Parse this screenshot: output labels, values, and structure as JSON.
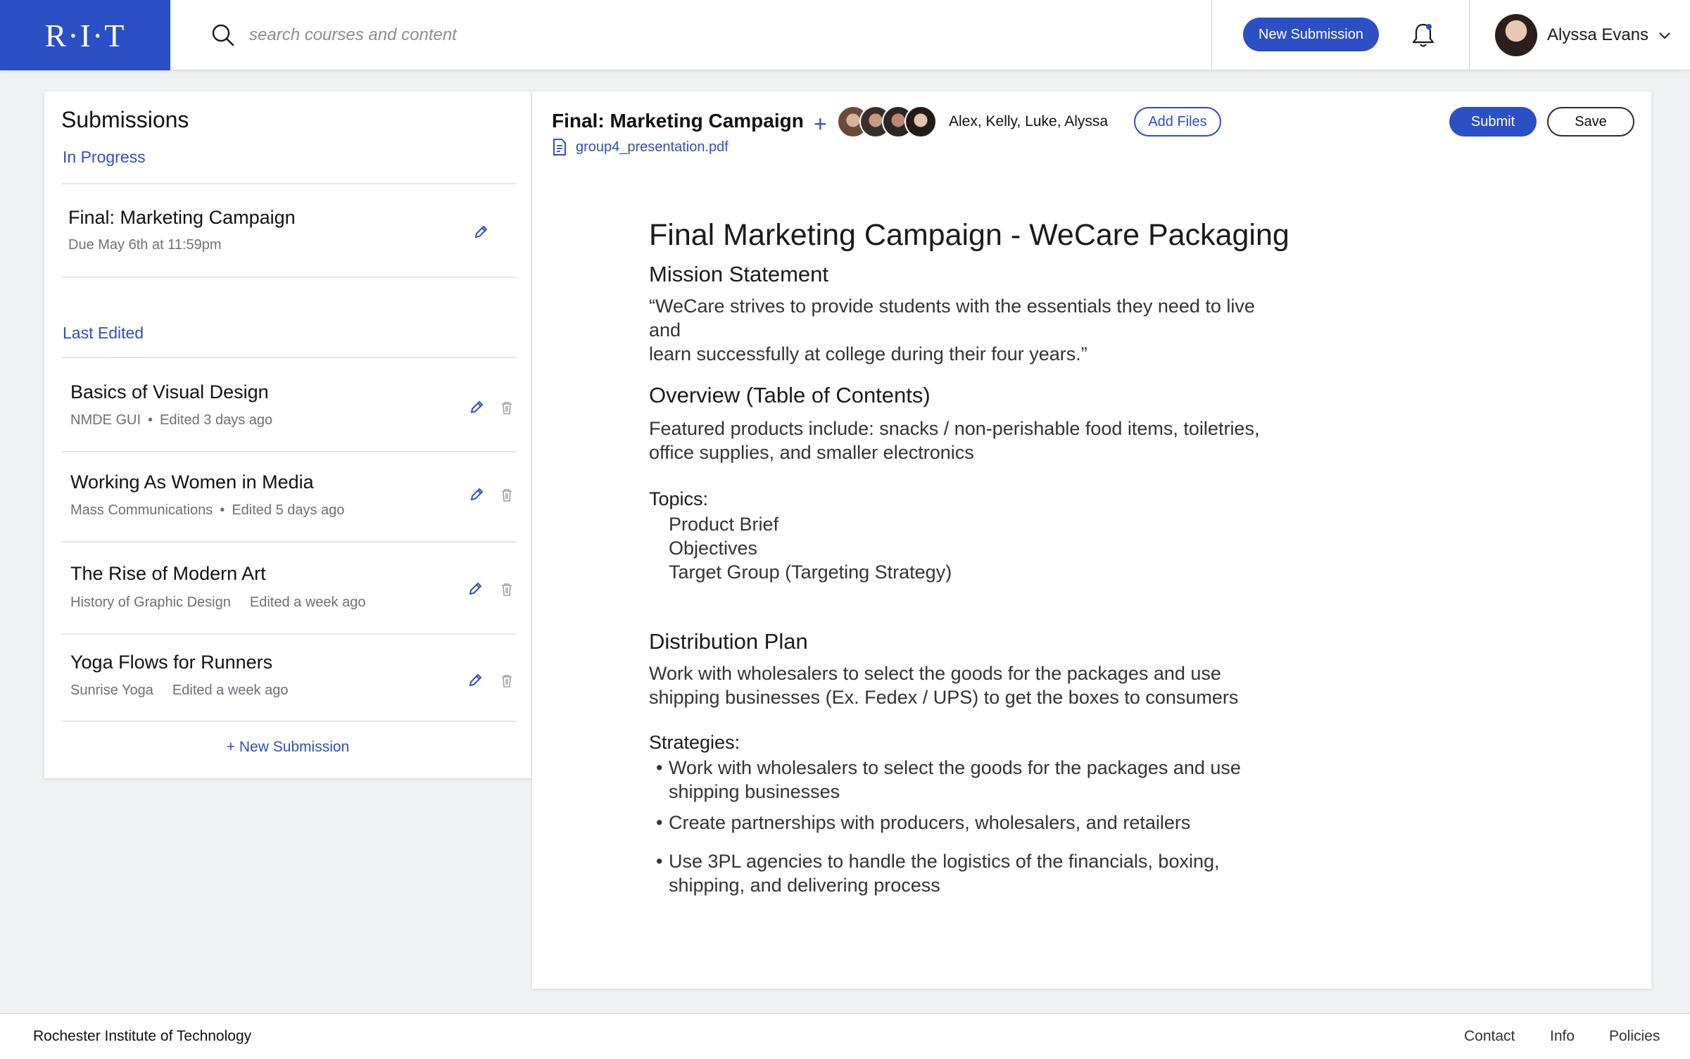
{
  "header": {
    "logo": "R·I·T",
    "search_placeholder": "search courses and content",
    "new_submission_label": "New Submission",
    "user_name": "Alyssa Evans"
  },
  "sidebar": {
    "title": "Submissions",
    "in_progress_label": "In Progress",
    "in_progress": {
      "title": "Final: Marketing Campaign",
      "due": "Due May 6th at 11:59pm"
    },
    "last_edited_label": "Last Edited",
    "items": [
      {
        "title": "Basics of Visual Design",
        "course": "NMDE GUI",
        "edited": "Edited 3 days ago"
      },
      {
        "title": "Working As Women in Media",
        "course": "Mass Communications",
        "edited": "Edited 5 days ago"
      },
      {
        "title": "The Rise of Modern Art",
        "course": "History of Graphic Design",
        "edited": "Edited a week ago"
      },
      {
        "title": "Yoga Flows for Runners",
        "course": "Sunrise Yoga",
        "edited": "Edited a week ago"
      }
    ],
    "new_submission_link": "+ New Submission"
  },
  "editor": {
    "title": "Final: Marketing Campaign",
    "collaborators": "Alex, Kelly, Luke, Alyssa",
    "add_files_label": "Add Files",
    "submit_label": "Submit",
    "save_label": "Save",
    "file_name": "group4_presentation.pdf"
  },
  "document": {
    "heading": "Final Marketing Campaign - WeCare Packaging",
    "mission_heading": "Mission Statement",
    "mission_line1": "“WeCare strives to provide students with the essentials they need to live and",
    "mission_line2": "learn successfully at college during their four years.”",
    "overview_heading": "Overview (Table of Contents)",
    "overview_line1": "Featured products include: snacks / non-perishable food items, toiletries,",
    "overview_line2": "office supplies, and smaller electronics",
    "topics_heading": "Topics:",
    "topics": [
      "Product Brief",
      "Objectives",
      "Target Group (Targeting Strategy)"
    ],
    "distribution_heading": "Distribution Plan",
    "distribution_line1": "Work with wholesalers to select the goods for the packages and use",
    "distribution_line2": "shipping businesses (Ex. Fedex / UPS)  to get the boxes to consumers",
    "strategies_heading": "Strategies:",
    "strategies": [
      {
        "line1": "Work with wholesalers to select the goods for the packages and use",
        "line2": "shipping businesses"
      },
      {
        "line1": "Create partnerships with producers, wholesalers, and retailers",
        "line2": ""
      },
      {
        "line1": "Use 3PL agencies to handle the logistics of the financials, boxing,",
        "line2": "shipping, and delivering process"
      }
    ]
  },
  "footer": {
    "org": "Rochester Institute of Technology",
    "contact": "Contact",
    "info": "Info",
    "policies": "Policies"
  },
  "colors": {
    "brand": "#2d4fc5",
    "background": "#f0f1f2"
  }
}
